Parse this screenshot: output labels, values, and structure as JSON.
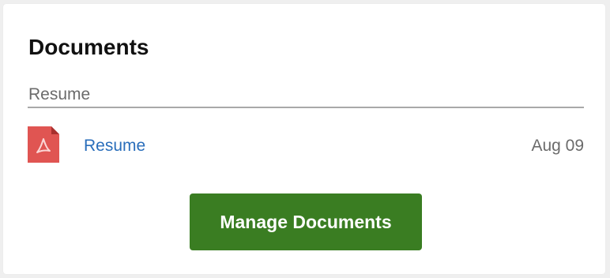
{
  "card": {
    "title": "Documents",
    "section_label": "Resume"
  },
  "documents": [
    {
      "icon": "pdf-file-icon",
      "name": "Resume",
      "date": "Aug 09"
    }
  ],
  "actions": {
    "manage_label": "Manage Documents"
  },
  "colors": {
    "accent_green": "#3a7d22",
    "link_blue": "#2a6ebb",
    "pdf_red": "#e05552"
  }
}
